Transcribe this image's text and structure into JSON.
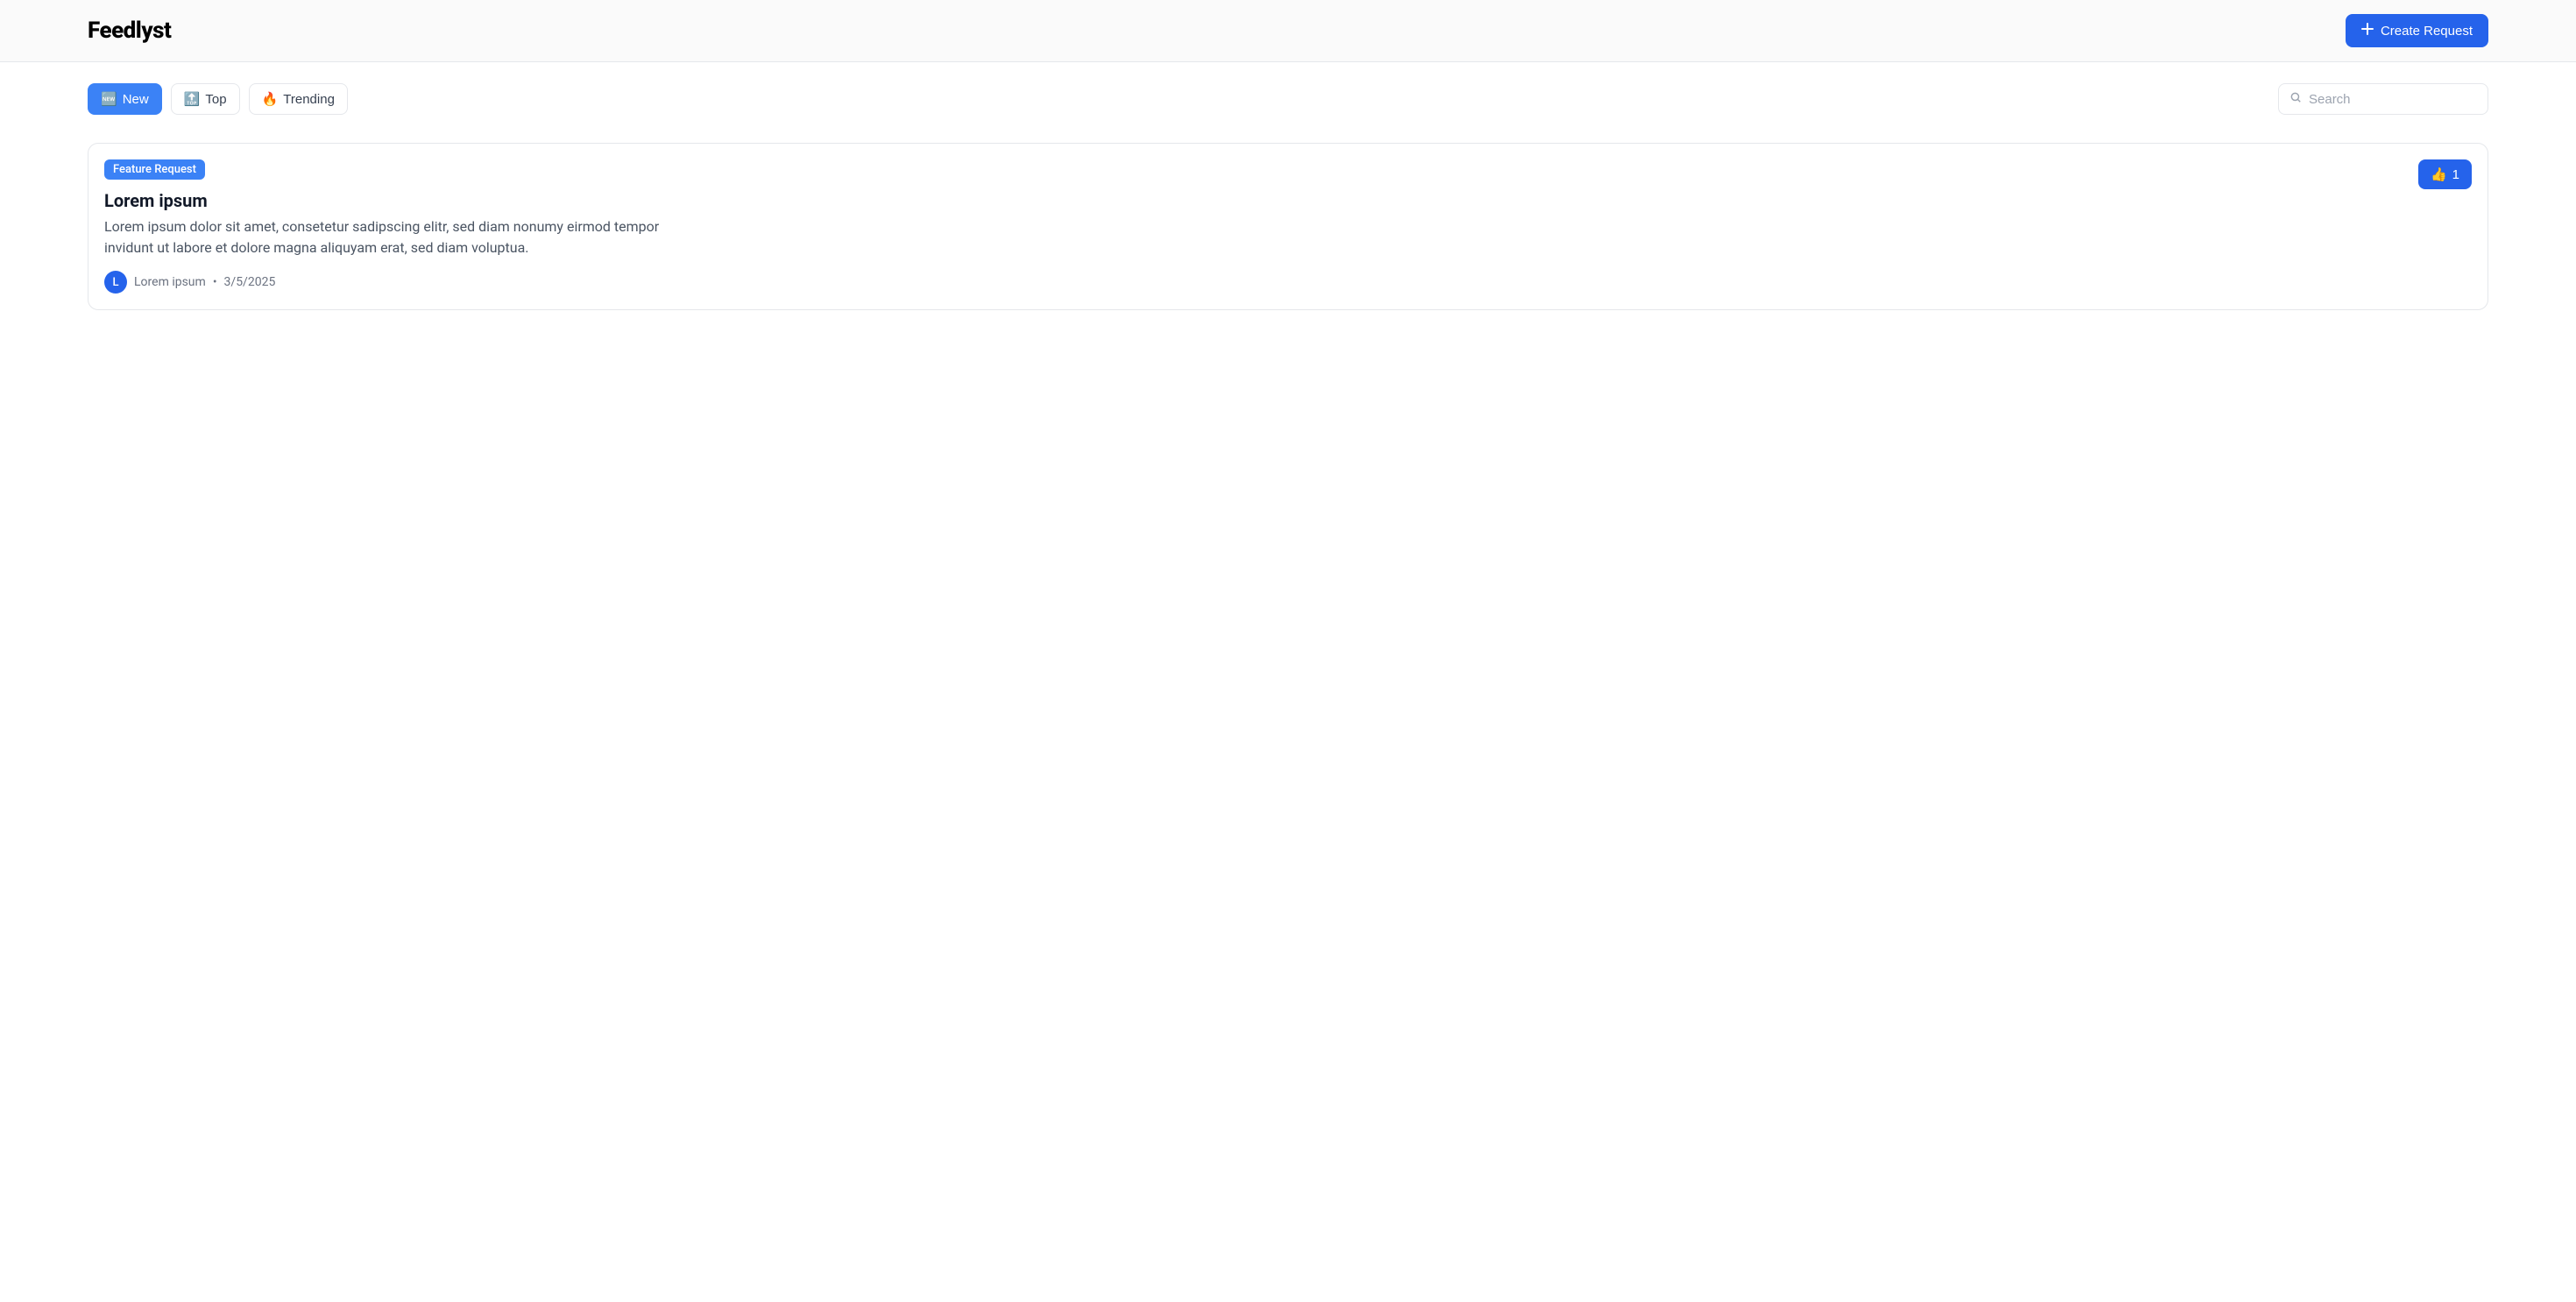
{
  "header": {
    "logo": "Feedlyst",
    "create_button": "Create Request"
  },
  "filters": {
    "new": {
      "icon": "🆕",
      "label": "New"
    },
    "top": {
      "icon": "🔝",
      "label": "Top"
    },
    "trending": {
      "icon": "🔥",
      "label": "Trending"
    }
  },
  "search": {
    "placeholder": "Search",
    "value": ""
  },
  "card": {
    "badge": "Feature Request",
    "title": "Lorem ipsum",
    "description": "Lorem ipsum dolor sit amet, consetetur sadipscing elitr, sed diam nonumy eirmod tempor invidunt ut labore et dolore magna aliquyam erat, sed diam voluptua.",
    "author": {
      "initial": "L",
      "name": "Lorem ipsum"
    },
    "date": "3/5/2025",
    "separator": "•",
    "upvote": {
      "icon": "👍",
      "count": "1"
    }
  }
}
